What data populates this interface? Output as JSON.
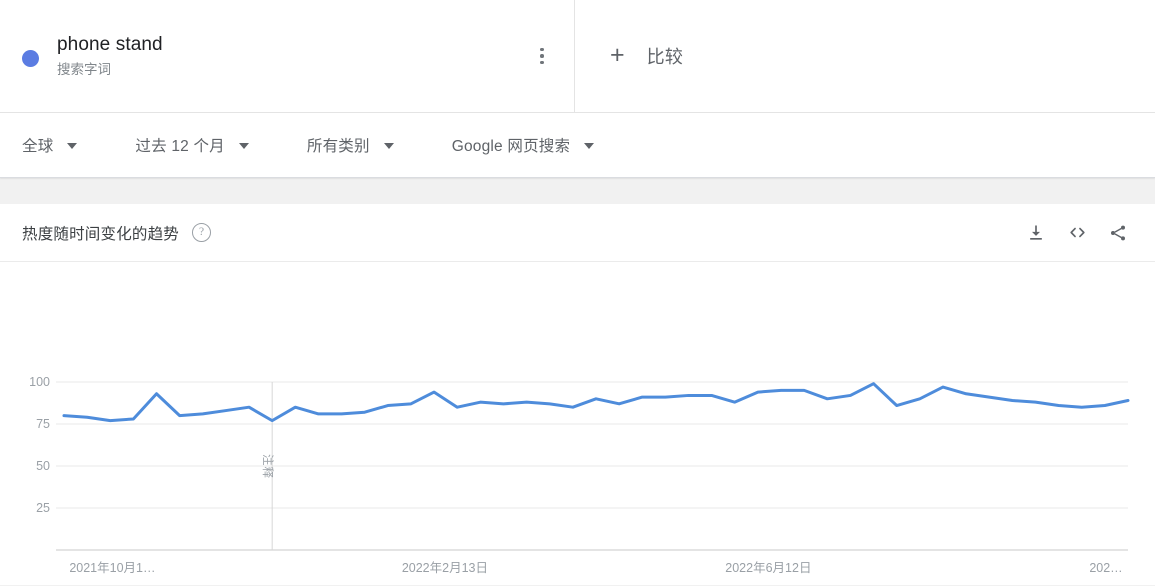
{
  "header": {
    "term": {
      "title": "phone stand",
      "subtitle": "搜索字词",
      "dot_color": "#5b7ce2",
      "menu_icon": "more-vert-icon"
    },
    "compare": {
      "plus_icon": "plus-icon",
      "label": "比较"
    }
  },
  "filters": [
    {
      "label": "全球",
      "caret_icon": "chevron-down-icon"
    },
    {
      "label": "过去 12 个月",
      "caret_icon": "chevron-down-icon"
    },
    {
      "label": "所有类别",
      "caret_icon": "chevron-down-icon"
    },
    {
      "label": "Google 网页搜索",
      "caret_icon": "chevron-down-icon"
    }
  ],
  "chart_card": {
    "title": "热度随时间变化的趋势",
    "help_icon": "help-icon",
    "help_glyph": "?",
    "actions": [
      {
        "name": "download-icon",
        "label": "下载"
      },
      {
        "name": "embed-code-icon",
        "label": "嵌入代码"
      },
      {
        "name": "share-icon",
        "label": "分享"
      }
    ]
  },
  "chart_data": {
    "type": "line",
    "title": "热度随时间变化的趋势",
    "xlabel": "",
    "ylabel": "",
    "ylim": [
      0,
      110
    ],
    "yticks": [
      25,
      50,
      75,
      100
    ],
    "grid": true,
    "legend_position": "none",
    "line_color": "#4e8cdb",
    "xtick_labels": [
      "2021年10月1…",
      "2022年2月13日",
      "2022年6月12日",
      "202…"
    ],
    "annotation": {
      "text": "注释",
      "x_index": 9,
      "orientation": "vertical",
      "line_color": "#d6d6d6"
    },
    "series": [
      {
        "name": "phone stand",
        "values": [
          80,
          79,
          77,
          78,
          93,
          80,
          81,
          83,
          85,
          77,
          85,
          81,
          81,
          82,
          86,
          87,
          94,
          85,
          88,
          87,
          88,
          87,
          85,
          90,
          87,
          91,
          91,
          92,
          92,
          88,
          94,
          95,
          95,
          90,
          92,
          99,
          86,
          90,
          97,
          93,
          91,
          89,
          88,
          86,
          85,
          86,
          89
        ]
      }
    ]
  }
}
